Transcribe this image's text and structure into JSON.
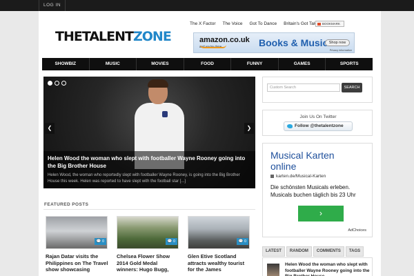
{
  "topbar": {
    "login_label": "LOG IN"
  },
  "logo": {
    "part1": "THETALENT",
    "part2": "ZONE"
  },
  "toplinks": [
    "The X Factor",
    "The Voice",
    "Got To Dance",
    "Britain's Got Talent"
  ],
  "bookmark_label": "BOOKMARK",
  "banner": {
    "brand": "amazon.co.uk",
    "tagline": "and you're done.",
    "headline": "Books & Music",
    "button": "Shop now",
    "privacy": "Privacy information"
  },
  "nav": [
    "SHOWBIZ",
    "MUSIC",
    "MOVIES",
    "FOOD",
    "FUNNY",
    "GAMES",
    "SPORTS"
  ],
  "slider": {
    "title": "Helen Wood the woman who slept with footballer Wayne Rooney going into the Big Brother House",
    "excerpt": "Helen Wood, the woman who reportedly slept with footballer Wayne Rooney, is going into the Big Brother House this week. Helen was reported to have slept with the football star [...]"
  },
  "search": {
    "placeholder": "Custom Search",
    "button": "SEARCH"
  },
  "twitter": {
    "title": "Join Us On Twitter",
    "follow": "Follow @thetalentzone"
  },
  "ad": {
    "headline": "Musical Karten online",
    "url": "karten.de/Musical-Karten",
    "body": "Die schönsten Musicals erleben. Musicals buchen täglich bis 23 Uhr",
    "button": "›",
    "choices": "AdChoices"
  },
  "featured": {
    "title": "FEATURED POSTS",
    "posts": [
      {
        "title": "Rajan Datar visits the Philippines on The Travel show showcasing",
        "comments": "0"
      },
      {
        "title": "Chelsea Flower Show 2014 Gold Medal winners: Hugo Bugg,",
        "comments": "0"
      },
      {
        "title": "Glen Etive Scotland attracts wealthy tourist for the James",
        "comments": "0"
      }
    ]
  },
  "tabs": [
    "LATEST",
    "RANDOM",
    "COMMENTS",
    "TAGS"
  ],
  "latest": [
    {
      "title": "Helen Wood the woman who slept with footballer Wayne Rooney going into the Big Brother House"
    }
  ]
}
